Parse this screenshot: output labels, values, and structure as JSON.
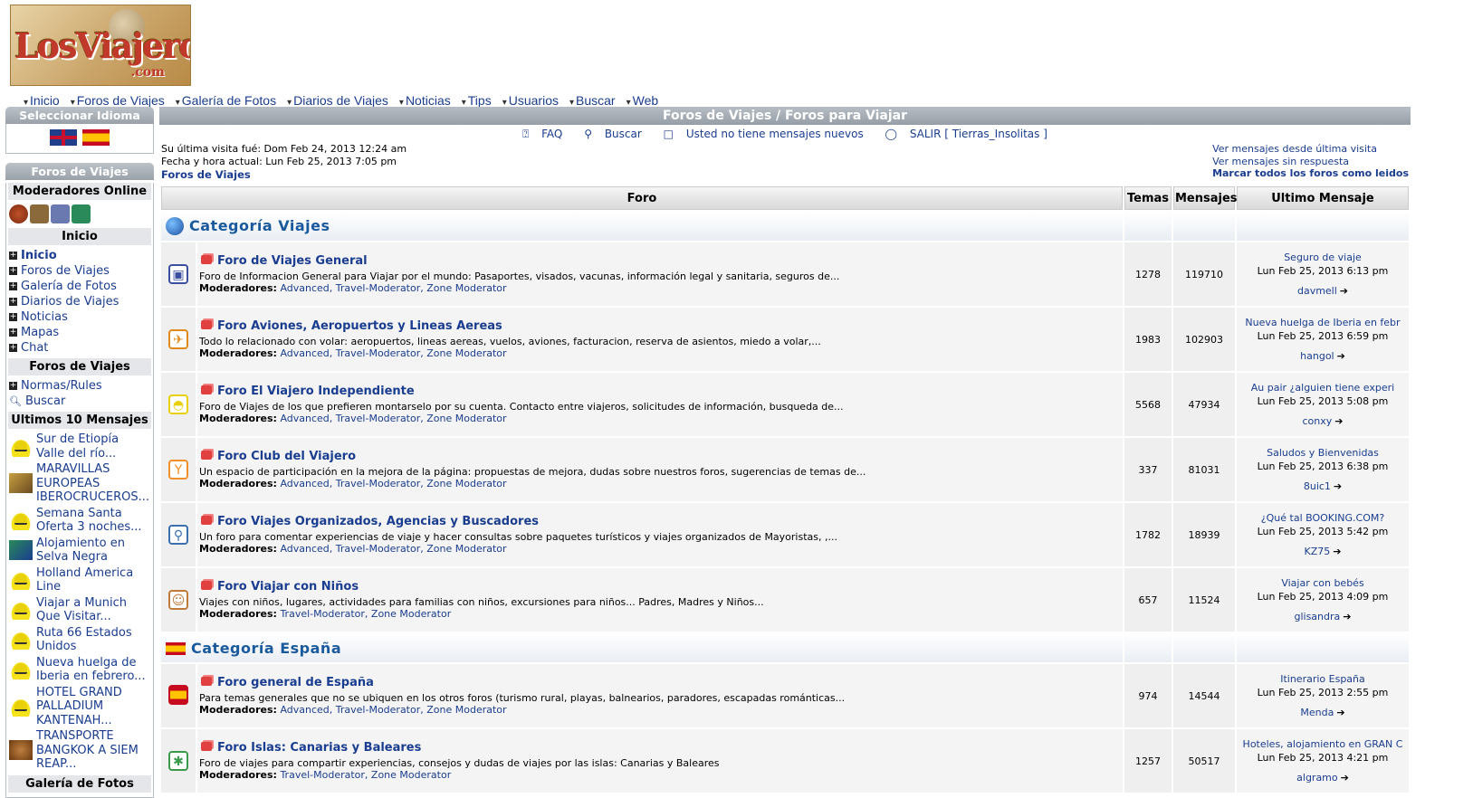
{
  "logo": {
    "text": "LosViajeros",
    "suffix": ".com"
  },
  "topnav": [
    "Inicio",
    "Foros de Viajes",
    "Galería de Fotos",
    "Diarios de Viajes",
    "Noticias",
    "Tips",
    "Usuarios",
    "Buscar",
    "Web"
  ],
  "sidebar": {
    "language_title": "Seleccionar Idioma",
    "foros_title": "Foros de Viajes",
    "moderators_title": "Moderadores Online",
    "inicio_title": "Inicio",
    "inicio_links": [
      "Inicio",
      "Foros de Viajes",
      "Galería de Fotos",
      "Diarios de Viajes",
      "Noticias",
      "Mapas",
      "Chat"
    ],
    "foros_sub": "Foros de Viajes",
    "foros_links": [
      "Normas/Rules",
      "Buscar"
    ],
    "last_title": "Ultimos 10 Mensajes",
    "last_messages": [
      "Sur de Etiopía Valle del río...",
      "MARAVILLAS EUROPEAS IBEROCRUCEROS...",
      "Semana Santa Oferta 3 noches...",
      "Alojamiento en Selva Negra",
      "Holland America Line",
      "Viajar a Munich Que Visitar...",
      "Ruta 66 Estados Unidos",
      "Nueva huelga de Iberia en febrero...",
      "HOTEL GRAND PALLADIUM KANTENAH...",
      "TRANSPORTE BANGKOK A SIEM REAP..."
    ],
    "gallery_title": "Galería de Fotos"
  },
  "main": {
    "title": "Foros de Viajes / Foros para Viajar",
    "links": [
      "FAQ",
      "Buscar",
      "Usted no tiene mensajes nuevos",
      "SALIR [ Tierras_Insolitas ]"
    ],
    "last_visit": "Su última visita fué: Dom Feb 24, 2013 12:24 am",
    "current_time": "Fecha y hora actual: Lun Feb 25, 2013 7:05 pm",
    "breadcrumb": "Foros de Viajes",
    "right_links": [
      "Ver mensajes desde última visita",
      "Ver mensajes sin respuesta",
      "Marcar todos los foros como leidos"
    ],
    "columns": [
      "Foro",
      "Temas",
      "Mensajes",
      "Ultimo Mensaje"
    ],
    "moderators_label": "Moderadores:",
    "categories": [
      {
        "name": "Categoría Viajes",
        "forums": [
          {
            "name": "Foro de Viajes General",
            "desc": "Foro de Informacion General para Viajar por el mundo: Pasaportes, visados, vacunas, información legal y sanitaria, seguros de...",
            "mods": "Advanced, Travel-Moderator, Zone Moderator",
            "topics": "1278",
            "posts": "119710",
            "last_title": "Seguro de viaje",
            "last_date": "Lun Feb 25, 2013 6:13 pm",
            "last_user": "davmell"
          },
          {
            "name": "Foro Aviones, Aeropuertos y Lineas Aereas",
            "desc": "Todo lo relacionado con volar: aeropuertos, lineas aereas, vuelos, aviones, facturacion, reserva de asientos, miedo a volar,...",
            "mods": "Advanced, Travel-Moderator, Zone Moderator",
            "topics": "1983",
            "posts": "102903",
            "last_title": "Nueva huelga de Iberia en febr",
            "last_date": "Lun Feb 25, 2013 6:59 pm",
            "last_user": "hangol"
          },
          {
            "name": "Foro El Viajero Independiente",
            "desc": "Foro de Viajes de los que prefieren montarselo por su cuenta. Contacto entre viajeros, solicitudes de información, busqueda de...",
            "mods": "Advanced, Travel-Moderator, Zone Moderator",
            "topics": "5568",
            "posts": "47934",
            "last_title": "Au pair ¿alguien tiene experi",
            "last_date": "Lun Feb 25, 2013 5:08 pm",
            "last_user": "conxy"
          },
          {
            "name": "Foro Club del Viajero",
            "desc": "Un espacio de participación en la mejora de la página: propuestas de mejora, dudas sobre nuestros foros, sugerencias de temas de...",
            "mods": "Advanced, Travel-Moderator, Zone Moderator",
            "topics": "337",
            "posts": "81031",
            "last_title": "Saludos y Bienvenidas",
            "last_date": "Lun Feb 25, 2013 6:38 pm",
            "last_user": "8uic1"
          },
          {
            "name": "Foro Viajes Organizados, Agencias y Buscadores",
            "desc": "Un foro para comentar experiencias de viaje y hacer consultas sobre paquetes turísticos y viajes organizados de Mayoristas, ,...",
            "mods": "Advanced, Travel-Moderator, Zone Moderator",
            "topics": "1782",
            "posts": "18939",
            "last_title": "¿Qué tal BOOKING.COM?",
            "last_date": "Lun Feb 25, 2013 5:42 pm",
            "last_user": "KZ75"
          },
          {
            "name": "Foro Viajar con Niños",
            "desc": "Viajes con niños, lugares, actividades para familias con niños, excursiones para niños... Padres, Madres y Niños...",
            "mods": "Travel-Moderator, Zone Moderator",
            "topics": "657",
            "posts": "11524",
            "last_title": "Viajar con bebés",
            "last_date": "Lun Feb 25, 2013 4:09 pm",
            "last_user": "glisandra"
          }
        ]
      },
      {
        "name": "Categoría España",
        "forums": [
          {
            "name": "Foro general de España",
            "desc": "Para temas generales que no se ubiquen en los otros foros (turismo rural, playas, balnearios, paradores, escapadas románticas...",
            "mods": "Advanced, Travel-Moderator, Zone Moderator",
            "topics": "974",
            "posts": "14544",
            "last_title": "Itinerario España",
            "last_date": "Lun Feb 25, 2013 2:55 pm",
            "last_user": "Menda"
          },
          {
            "name": "Foro Islas: Canarias y Baleares",
            "desc": "Foro de viajes para compartir experiencias, consejos y dudas de viajes por las islas: Canarias y Baleares",
            "mods": "Travel-Moderator, Zone Moderator",
            "topics": "1257",
            "posts": "50517",
            "last_title": "Hoteles, alojamiento en GRAN C",
            "last_date": "Lun Feb 25, 2013 4:21 pm",
            "last_user": "algramo"
          }
        ]
      }
    ]
  },
  "icons": {
    "forum_icons": [
      "suitcase-icon",
      "airplane-icon",
      "hat-icon",
      "cocktail-icon",
      "magnifier-icon",
      "child-icon",
      "spain-flag-icon",
      "palm-island-icon"
    ],
    "forum_icon_colors": [
      "#3b4fa0",
      "#e08a1e",
      "#e8d10a",
      "#f0902a",
      "#3a6fb0",
      "#c07a3a",
      "#c60b1e",
      "#3a9a4a"
    ]
  }
}
